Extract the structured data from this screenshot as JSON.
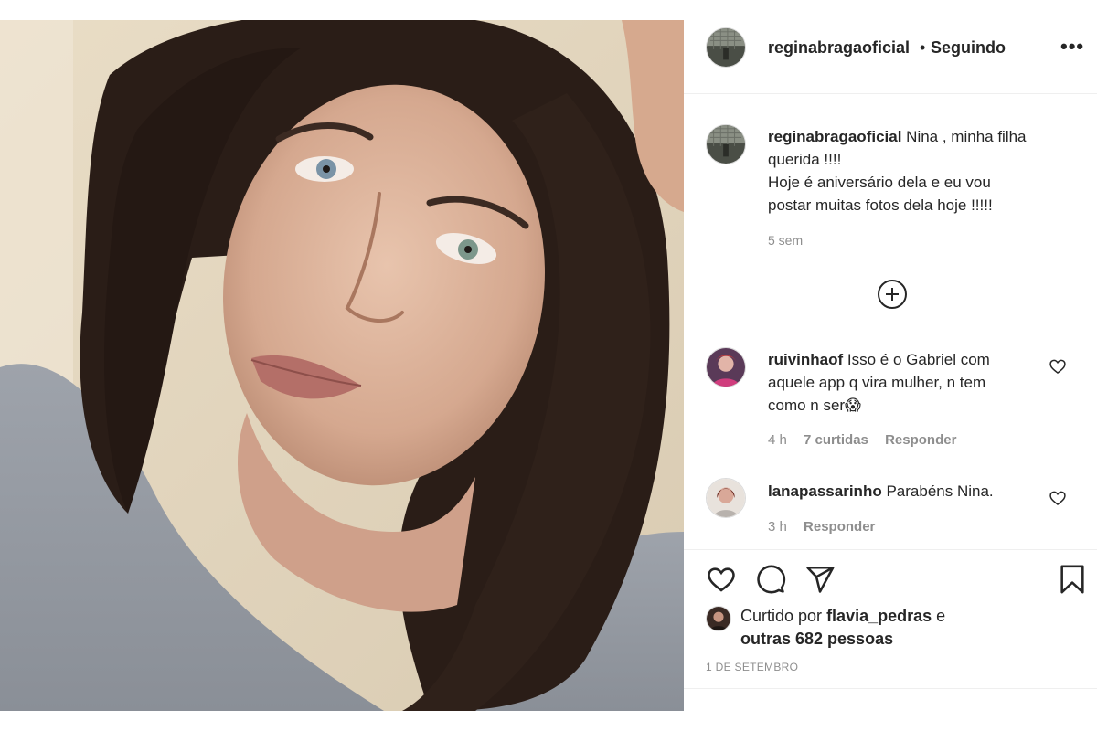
{
  "post": {
    "username": "reginabragaoficial",
    "separator": "•",
    "follow_state": "Seguindo",
    "more_icon": "more-icon",
    "photo_description_icon": "post-photo"
  },
  "caption": {
    "username": "reginabragaoficial",
    "line1": "Nina , minha filha",
    "line2": "querida !!!!",
    "line3": "Hoje é aniversário dela e eu vou",
    "line4": "postar muitas fotos dela hoje !!!!!",
    "time": "5 sem"
  },
  "load_more_icon": "plus-circle-icon",
  "comments": [
    {
      "username": "ruivinhaof",
      "line1": "Isso é o Gabriel com",
      "line2": "aquele app q vira mulher, n tem",
      "line3": "como n ser😱",
      "time": "4 h",
      "likes": "7 curtidas",
      "reply": "Responder"
    },
    {
      "username": "lanapassarinho",
      "line1": "Parabéns Nina.",
      "time": "3 h",
      "reply": "Responder"
    }
  ],
  "likes": {
    "prefix": "Curtido por",
    "user": "flavia_pedras",
    "conj": "e",
    "others": "outras 682 pessoas"
  },
  "date": "1 DE SETEMBRO",
  "colors": {
    "text": "#262626",
    "secondary": "#8e8e8e",
    "divider": "#efefef"
  }
}
